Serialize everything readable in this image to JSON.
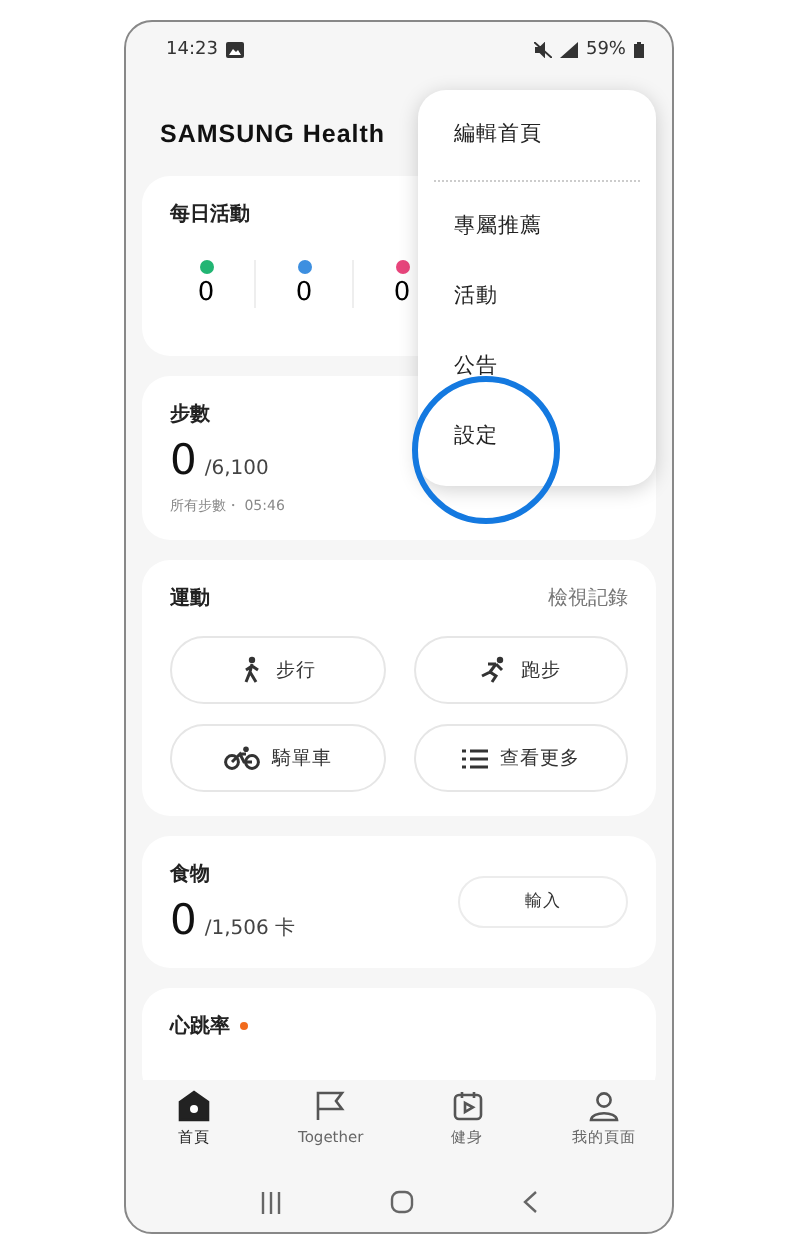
{
  "status_bar": {
    "time": "14:23",
    "battery": "59%"
  },
  "app_title": "SAMSUNG Health",
  "daily_activity": {
    "title": "每日活動",
    "stats": [
      {
        "value": "0",
        "color": "#22b573"
      },
      {
        "value": "0",
        "color": "#3d8fe0"
      },
      {
        "value": "0",
        "color": "#e8457c"
      }
    ]
  },
  "steps": {
    "title": "步數",
    "value": "0",
    "goal": "/6,100",
    "note": "所有步數・ 05:46"
  },
  "exercise": {
    "title": "運動",
    "link": "檢視記錄",
    "buttons": [
      {
        "kind": "walk",
        "label": "步行"
      },
      {
        "kind": "run",
        "label": "跑步"
      },
      {
        "kind": "bike",
        "label": "騎單車"
      },
      {
        "kind": "list",
        "label": "查看更多"
      }
    ]
  },
  "food": {
    "title": "食物",
    "value": "0",
    "goal": "/1,506 卡",
    "button": "輸入"
  },
  "heart_rate": {
    "title": "心跳率",
    "new_dot": true
  },
  "menu": {
    "items": [
      {
        "label": "編輯首頁",
        "highlighted": false
      },
      {
        "label": "專屬推薦",
        "highlighted": false
      },
      {
        "label": "活動",
        "highlighted": false
      },
      {
        "label": "公告",
        "highlighted": false
      },
      {
        "label": "設定",
        "highlighted": true
      }
    ]
  },
  "bottom_nav": [
    {
      "kind": "home",
      "label": "首頁",
      "selected": true
    },
    {
      "kind": "flag",
      "label": "Together",
      "selected": false
    },
    {
      "kind": "fitness",
      "label": "健身",
      "selected": false
    },
    {
      "kind": "person",
      "label": "我的頁面",
      "selected": false
    }
  ]
}
